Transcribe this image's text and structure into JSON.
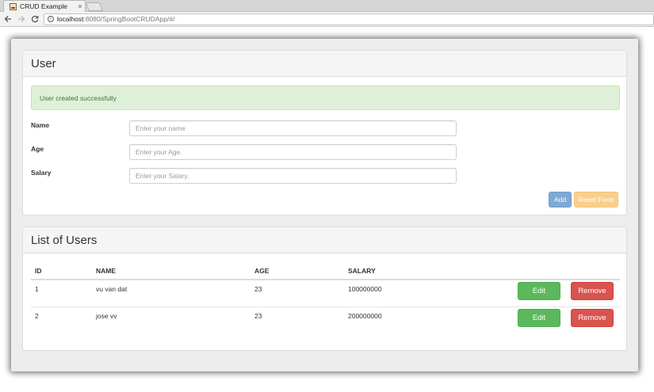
{
  "browser": {
    "tab_title": "CRUD Example",
    "tab_close": "×",
    "url_host": "localhost",
    "url_rest": ":8080/SpringBootCRUDApp/#/"
  },
  "user_panel": {
    "title": "User",
    "alert": "User created successfully",
    "fields": [
      {
        "label": "Name",
        "placeholder": "Enter your name",
        "value": ""
      },
      {
        "label": "Age",
        "placeholder": "Enter your Age.",
        "value": ""
      },
      {
        "label": "Salary",
        "placeholder": "Enter your Salary.",
        "value": ""
      }
    ],
    "add_label": "Add",
    "reset_label": "Reset Form"
  },
  "list_panel": {
    "title": "List of Users",
    "columns": [
      "ID",
      "NAME",
      "AGE",
      "SALARY"
    ],
    "rows": [
      {
        "id": "1",
        "name": "vu van dat",
        "age": "23",
        "salary": "100000000"
      },
      {
        "id": "2",
        "name": "jose vv",
        "age": "23",
        "salary": "200000000"
      }
    ],
    "edit_label": "Edit",
    "remove_label": "Remove"
  },
  "colors": {
    "success_alert_bg": "#dff0d8",
    "success_alert_text": "#3c763d",
    "primary": "#7ea9d3",
    "warning": "#f8cf8c",
    "edit": "#5cb85c",
    "remove": "#d9534f"
  }
}
